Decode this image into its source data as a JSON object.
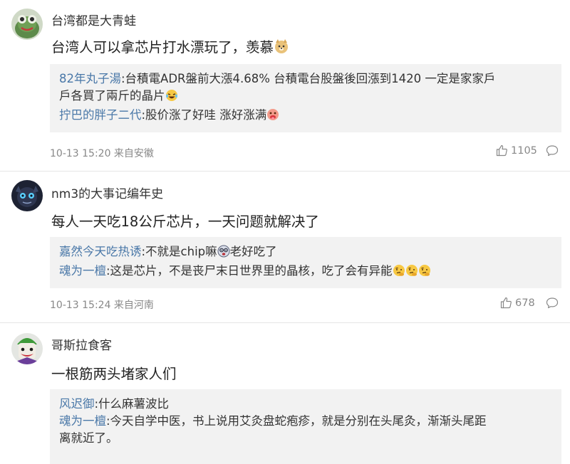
{
  "comments": [
    {
      "user": "台湾都是大青蛙",
      "text": "台湾人可以拿芯片打水漂玩了，羡慕",
      "text_emoji": "doge-emoji",
      "replies": [
        {
          "name": "82年丸子湯",
          "text_line1": ":台積電ADR盤前大漲4.68% 台積電台股盤後回漲到1420 一定是家家戶",
          "text_line2": "戶各買了兩斤的晶片",
          "emoji": "laughing-tears-emoji"
        },
        {
          "name": "拧巴的胖子二代",
          "text": ":股价涨了好哇 涨好涨满",
          "emoji": "greedy-face-emoji"
        }
      ],
      "time_location": "10-13 15:20 来自安徽",
      "likes": "1105"
    },
    {
      "user": "nm3的大事记编年史",
      "text": "每人一天吃18公斤芯片，一天问题就解决了",
      "replies": [
        {
          "name": "嘉然今天吃热诱",
          "text_before": ":不就是chip嘛",
          "emoji": "dizzy-face-emoji",
          "text_after": "老好吃了"
        },
        {
          "name": "魂为一檀",
          "text": ":这是芯片，不是丧尸末日世界里的晶核，吃了会有异能",
          "emoji": "thinking-face-emoji x3"
        }
      ],
      "time_location": "10-13 15:24 来自河南",
      "likes": "678"
    },
    {
      "user": "哥斯拉食客",
      "text": "一根筋两头堵家人们",
      "replies": [
        {
          "name": "风迟御",
          "text": ":什么麻薯波比"
        },
        {
          "name": "魂为一檀",
          "text_line1": ":今天自学中医，书上说用艾灸盘蛇疱疹，就是分别在头尾灸，渐渐头尾距",
          "text_line2": "离就近了。"
        }
      ]
    }
  ],
  "icons": {
    "like": "thumbs-up-icon",
    "reply": "comment-bubble-icon"
  },
  "colors": {
    "reply_name": "#4a78a8",
    "reply_background": "#f2f2f2",
    "meta_text": "#888888"
  }
}
